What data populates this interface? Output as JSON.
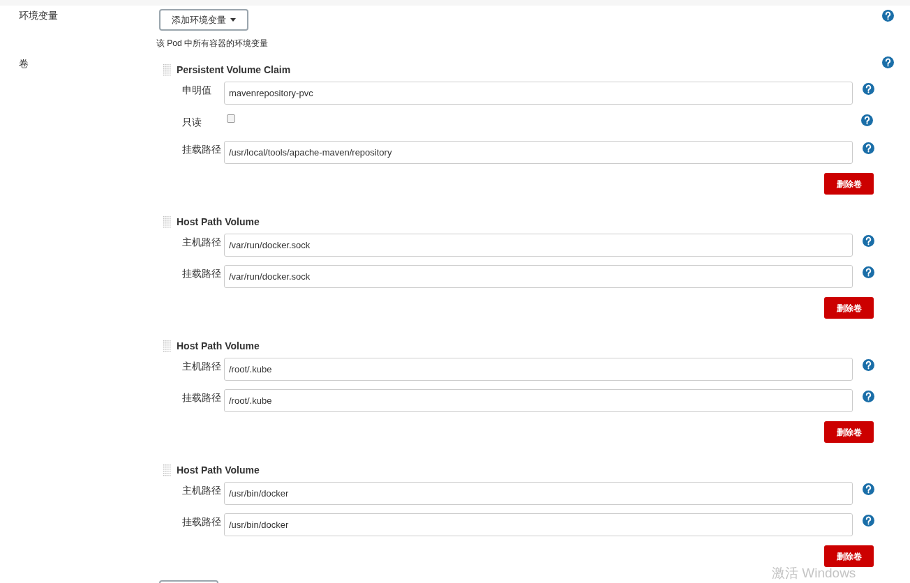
{
  "env": {
    "label": "环境变量",
    "button": "添加环境变量",
    "hint": "该 Pod 中所有容器的环境变量"
  },
  "volumes_label": "卷",
  "volumes": [
    {
      "title": "Persistent Volume Claim",
      "fields": [
        {
          "kind": "text",
          "label": "申明值",
          "value": "mavenrepository-pvc"
        },
        {
          "kind": "checkbox",
          "label": "只读",
          "checked": false
        },
        {
          "kind": "text",
          "label": "挂载路径",
          "value": "/usr/local/tools/apache-maven/repository"
        }
      ],
      "delete_button": "删除卷"
    },
    {
      "title": "Host Path Volume",
      "fields": [
        {
          "kind": "text",
          "label": "主机路径",
          "value": "/var/run/docker.sock"
        },
        {
          "kind": "text",
          "label": "挂载路径",
          "value": "/var/run/docker.sock"
        }
      ],
      "delete_button": "删除卷"
    },
    {
      "title": "Host Path Volume",
      "fields": [
        {
          "kind": "text",
          "label": "主机路径",
          "value": "/root/.kube"
        },
        {
          "kind": "text",
          "label": "挂载路径",
          "value": "/root/.kube"
        }
      ],
      "delete_button": "删除卷"
    },
    {
      "title": "Host Path Volume",
      "fields": [
        {
          "kind": "text",
          "label": "主机路径",
          "value": "/usr/bin/docker"
        },
        {
          "kind": "text",
          "label": "挂载路径",
          "value": "/usr/bin/docker"
        }
      ],
      "delete_button": "删除卷"
    }
  ],
  "os_watermark": "激活 Windows"
}
